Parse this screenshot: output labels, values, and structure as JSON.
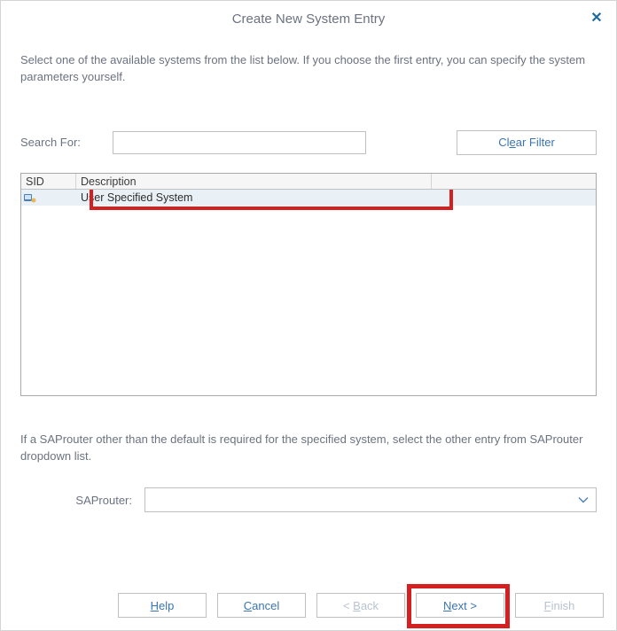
{
  "dialog": {
    "title": "Create New System Entry",
    "close_symbol": "✕",
    "instructions": "Select one of the available systems from the list below. If you choose the first entry, you can specify the system parameters yourself."
  },
  "search": {
    "label": "Search For:",
    "value": "",
    "clear_prefix": "Cl",
    "clear_ul": "e",
    "clear_suffix": "ar Filter"
  },
  "table": {
    "headers": {
      "sid": "SID",
      "description": "Description"
    },
    "rows": [
      {
        "sid_icon": "system-icon",
        "description": "User Specified System"
      }
    ]
  },
  "saprouter": {
    "note": "If a SAProuter other than the default is required for the specified system, select the other entry from SAProuter dropdown list.",
    "label": "SAProuter:",
    "value": ""
  },
  "buttons": {
    "help_ul": "H",
    "help_rest": "elp",
    "cancel_ul": "C",
    "cancel_rest": "ancel",
    "back_prefix": "< ",
    "back_ul": "B",
    "back_rest": "ack",
    "next_ul": "N",
    "next_rest": "ext >",
    "finish_ul": "F",
    "finish_rest": "inish"
  }
}
